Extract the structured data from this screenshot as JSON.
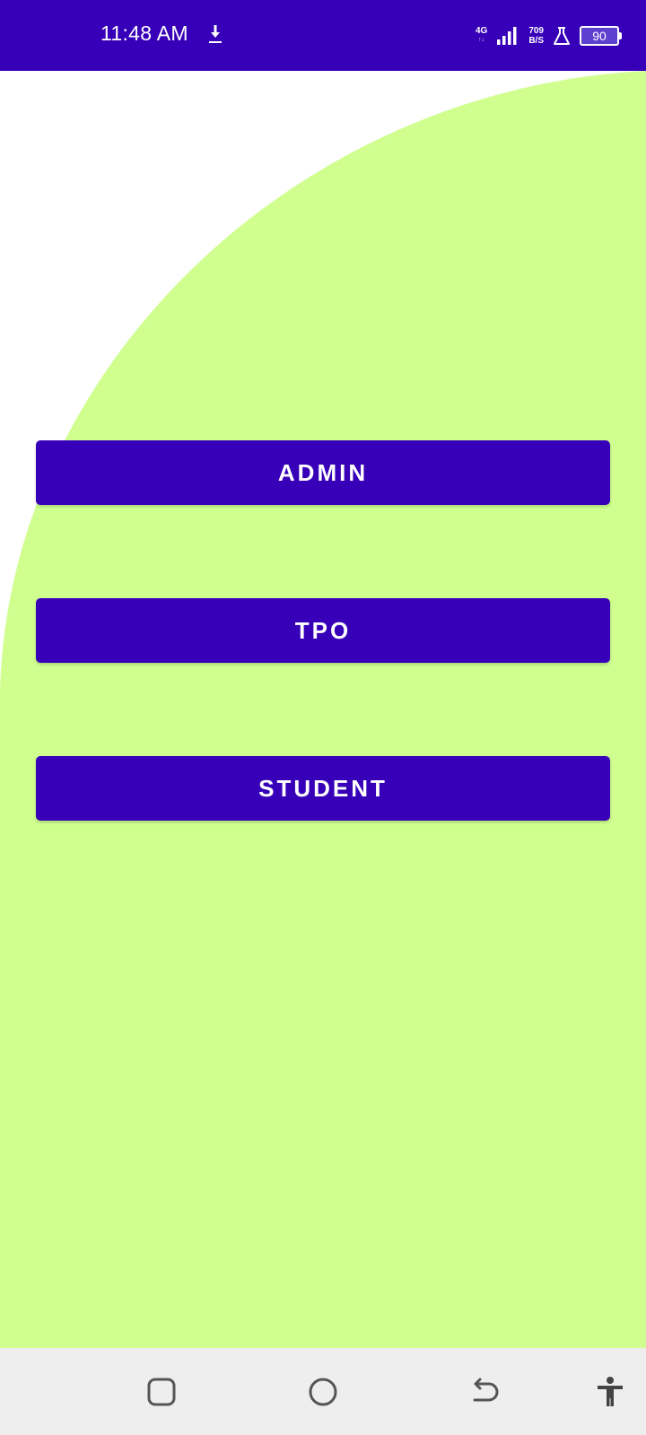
{
  "status_bar": {
    "time": "11:48 AM",
    "network_type": "4G",
    "network_sub": "↑↓",
    "speed_value": "709",
    "speed_unit": "B/S",
    "battery_level": "90",
    "background_color": "#3700b8",
    "icons": [
      "download-icon",
      "signal-icon",
      "flask-icon",
      "battery-icon"
    ]
  },
  "main": {
    "background_color": "#ffffff",
    "blob_color": "#d0ff90",
    "buttons": [
      {
        "label": "ADMIN",
        "color": "#3700b8"
      },
      {
        "label": "TPO",
        "color": "#3700b8"
      },
      {
        "label": "STUDENT",
        "color": "#3700b8"
      }
    ]
  },
  "nav_bar": {
    "background_color": "#eeeeee",
    "icons": [
      "recents-icon",
      "home-icon",
      "back-icon",
      "accessibility-icon"
    ]
  }
}
